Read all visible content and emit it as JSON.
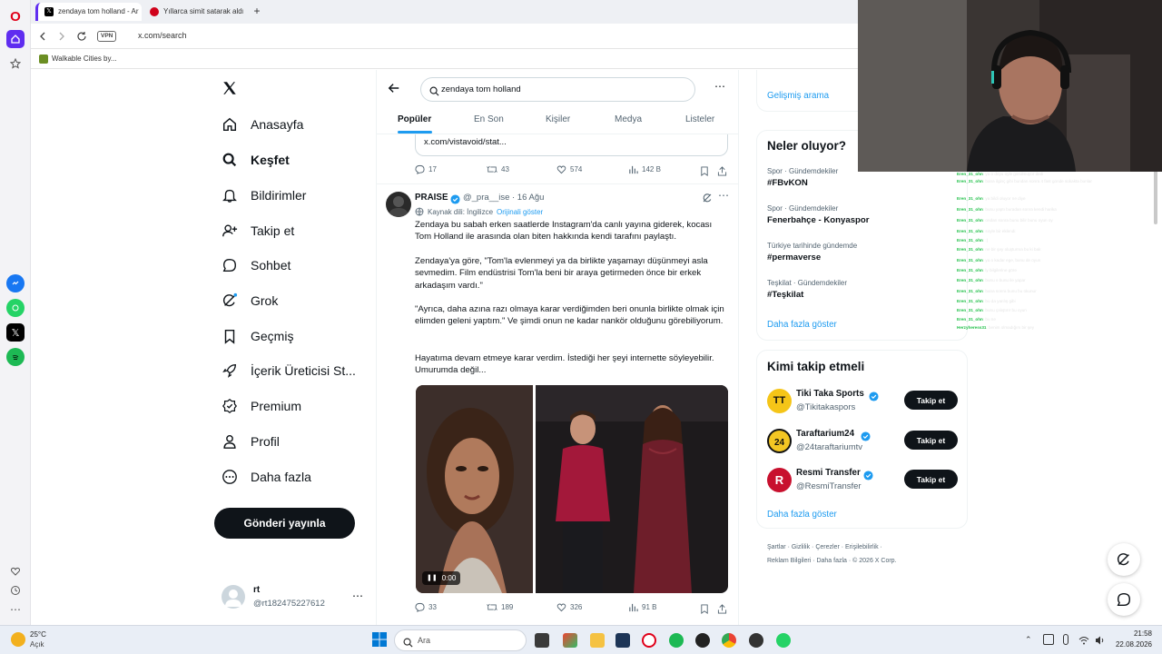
{
  "browser": {
    "tabs": [
      {
        "title": "zendaya tom holland - Ar",
        "active": true
      },
      {
        "title": "Yıllarca simit satarak aldığı",
        "active": false
      }
    ],
    "new_tab_symbol": "+",
    "vpn_label": "VPN",
    "url": "x.com/search",
    "bookmark": "Walkable Cities by..."
  },
  "x": {
    "nav": [
      {
        "label": "Anasayfa",
        "icon": "home-icon"
      },
      {
        "label": "Keşfet",
        "icon": "search-icon"
      },
      {
        "label": "Bildirimler",
        "icon": "bell-icon"
      },
      {
        "label": "Takip et",
        "icon": "follow-icon"
      },
      {
        "label": "Sohbet",
        "icon": "chat-icon"
      },
      {
        "label": "Grok",
        "icon": "grok-icon"
      },
      {
        "label": "Geçmiş",
        "icon": "bookmark-icon"
      },
      {
        "label": "İçerik Üreticisi St...",
        "icon": "rocket-icon"
      },
      {
        "label": "Premium",
        "icon": "premium-icon"
      },
      {
        "label": "Profil",
        "icon": "profile-icon"
      },
      {
        "label": "Daha fazla",
        "icon": "more-icon"
      }
    ],
    "post_button": "Gönderi yayınla",
    "account": {
      "name": "rt",
      "handle": "@rt182475227612"
    },
    "search_value": "zendaya tom holland",
    "tabs": [
      "Popüler",
      "En Son",
      "Kişiler",
      "Medya",
      "Listeler"
    ],
    "prev_tweet": {
      "link": "x.com/vistavoid/stat...",
      "replies": "17",
      "reposts": "43",
      "likes": "574",
      "views": "142 B"
    },
    "tweet": {
      "name": "PRAISE",
      "handle": "@_pra__ise",
      "date": "· 16 Ağu",
      "source_lang": "Kaynak dili: İngilizce",
      "show_original": "Orijinali göster",
      "paragraphs": [
        "Zendaya bu sabah erken saatlerde Instagram'da canlı yayına giderek, kocası Tom Holland ile arasında olan biten hakkında kendi tarafını paylaştı.",
        "Zendaya'ya göre, \"Tom'la evlenmeyi ya da birlikte yaşamayı düşünmeyi asla sevmedim. Film endüstrisi Tom'la beni bir araya getirmeden önce bir erkek arkadaşım vardı.\"",
        "\"Ayrıca, daha azına razı olmaya karar verdiğimden beri onunla birlikte olmak için elimden geleni yaptım.\" Ve şimdi onun ne kadar nankör olduğunu görebiliyorum.",
        "Hayatıma devam etmeye karar verdim. İstediği her şeyi internette söyleyebilir. Umurumda değil..."
      ],
      "video_time": "0:00",
      "replies": "33",
      "reposts": "189",
      "likes": "326",
      "views": "91 B"
    },
    "right": {
      "advanced_search": "Gelişmiş arama",
      "trends_title": "Neler oluyor?",
      "trends": [
        {
          "category": "Spor · Gündemdekiler",
          "name": "#FBvKON"
        },
        {
          "category": "Spor · Gündemdekiler",
          "name": "Fenerbahçe - Konyaspor"
        },
        {
          "category": "Türkiye tarihinde gündemde",
          "name": "#permaverse"
        },
        {
          "category": "Teşkilat · Gündemdekiler",
          "name": "#Teşkilat"
        }
      ],
      "trends_more": "Daha fazla göster",
      "who_title": "Kimi takip etmeli",
      "who": [
        {
          "name": "Tiki Taka Sports",
          "handle": "@Tikitakaspors",
          "avatar_text": "TT",
          "avatar_color": "#f5c518"
        },
        {
          "name": "Taraftarium24",
          "handle": "@24taraftariumtv",
          "avatar_text": "24",
          "avatar_color": "#f3c623"
        },
        {
          "name": "Resmi Transfer",
          "handle": "@ResmiTransfer",
          "avatar_text": "R",
          "avatar_color": "#c8102e"
        }
      ],
      "follow_label": "Takip et",
      "who_more": "Daha fazla göster",
      "footer_line1": [
        "Şartlar",
        "Gizlilik",
        "Çerezler",
        "Erişilebilirlik"
      ],
      "footer_line2": [
        "Reklam Bilgileri",
        "Daha fazla",
        "© 2026 X Corp."
      ]
    }
  },
  "chat": [
    {
      "user": "Eren_31_ohn",
      "msg": ": ya o doyu oyle gorulmuyor dedi"
    },
    {
      "user": "Eren_31_ohn",
      "msg": ": bana ilginç gibi bundan sonra 4 fast gonde sokakta bunlar"
    },
    {
      "user": "Eren_31_ohn",
      "msg": ": ya bildi oluyor ne diye"
    },
    {
      "user": "Eren_31_ohn",
      "msg": ": bunu yaptı buradan sonra kendi harika"
    },
    {
      "user": "Eren_31_ohn",
      "msg": ": ondan sonra bunu bilir bunu oyun oy"
    },
    {
      "user": "Eren_31_ohn",
      "msg": ": soyle bir eklendi"
    },
    {
      "user": "Eren_31_ohn",
      "msg": ": :)"
    },
    {
      "user": "Eren_31_ohn",
      "msg": ": ne bir şey oluşturma bu ki bak"
    },
    {
      "user": "Eren_31_ohn",
      "msg": ": ya o kadar ege, bunu de oyun"
    },
    {
      "user": "Eren_31_ohn",
      "msg": ": ly bilgilerine göre"
    },
    {
      "user": "Eren_31_ohn",
      "msg": ": bunu o bunu ile yapar"
    },
    {
      "user": "Eren_31_ohn",
      "msg": ": bana sonra bunu bu okunur"
    },
    {
      "user": "Eren_31_ohn",
      "msg": ": bu da yanlış gibi"
    },
    {
      "user": "Eren_31_ohn",
      "msg": ": bunu çalıştırır bu oyun"
    },
    {
      "user": "Eren_31_ohn",
      "msg": ": bu ne"
    },
    {
      "user": "Herzyheress31",
      "msg": ": benim olmadığım bir şey"
    }
  ],
  "taskbar": {
    "weather_temp": "25°C",
    "weather_desc": "Açık",
    "search_placeholder": "Ara",
    "time": "21:58",
    "date": "22.08.2026"
  }
}
